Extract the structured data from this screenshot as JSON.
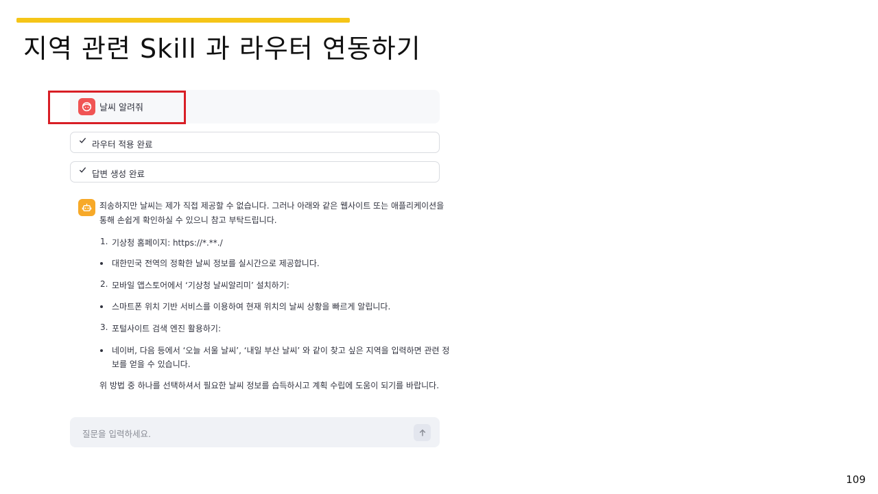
{
  "slide": {
    "title": "지역 관련 Skill 과 라우터 연동하기",
    "page_number": "109",
    "accent_color": "#f5c518",
    "highlight_color": "#d81e25"
  },
  "chat": {
    "user_message": "날씨 알려줘",
    "user_avatar_icon": "user-face-icon",
    "status_items": [
      {
        "icon": "check-icon",
        "label": "라우터 적용 완료"
      },
      {
        "icon": "check-icon",
        "label": "답변 생성 완료"
      }
    ],
    "bot_avatar_icon": "robot-icon",
    "bot_intro_line1": "죄송하지만 날씨는 제가 직접 제공할 수 없습니다. 그러나 아래와 같은 웹사이트 또는 애플리케이션을",
    "bot_intro_line2": "통해 손쉽게 확인하실 수 있으니 참고 부탁드립니다.",
    "list": [
      {
        "type": "ordered",
        "marker": "1.",
        "text": "기상청 홈페이지: https://*.**./"
      },
      {
        "type": "bullet",
        "text": "대한민국 전역의 정확한 날씨 정보를 실시간으로 제공합니다."
      },
      {
        "type": "ordered",
        "marker": "2.",
        "text": "모바일 앱스토어에서 ‘기상청 날씨알리미’ 설치하기:"
      },
      {
        "type": "bullet",
        "text": "스마트폰 위치 기반 서비스를 이용하여 현재 위치의 날씨 상황을 빠르게 알립니다."
      },
      {
        "type": "ordered",
        "marker": "3.",
        "text": "포털사이트 검색 엔진 활용하기:"
      },
      {
        "type": "bullet",
        "text": "네이버, 다음 등에서 ‘오늘 서울 날씨’, ‘내일 부산 날씨’ 와 같이 찾고 싶은 지역을 입력하면 관련 정",
        "text2": "보를 얻을 수 있습니다."
      }
    ],
    "bot_outro": "위 방법 중 하나를 선택하셔서 필요한 날씨 정보를 습득하시고 계획 수립에 도움이 되기를 바랍니다.",
    "input_placeholder": "질문을 입력하세요.",
    "send_icon": "arrow-up-icon"
  }
}
